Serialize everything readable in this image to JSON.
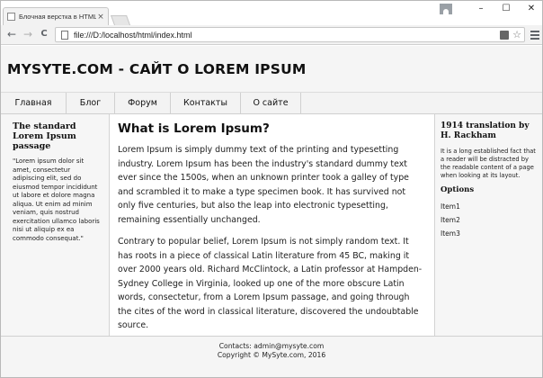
{
  "browser": {
    "tab_title": "Блочная верстка в HTML",
    "tab_close": "×",
    "window_controls": {
      "minimize": "–",
      "maximize": "☐",
      "close": "✕"
    },
    "nav": {
      "back": "←",
      "forward": "→",
      "reload": "C"
    },
    "address": "file:///D:/localhost/html/index.html",
    "star": "☆"
  },
  "site": {
    "title": "MYSYTE.COM - САЙТ О LOREM IPSUM",
    "menu": [
      "Главная",
      "Блог",
      "Форум",
      "Контакты",
      "О сайте"
    ]
  },
  "left": {
    "heading": "The standard Lorem Ipsum passage",
    "text": "\"Lorem ipsum dolor sit amet, consectetur adipiscing elit, sed do eiusmod tempor incididunt ut labore et dolore magna aliqua. Ut enim ad minim veniam, quis nostrud exercitation ullamco laboris nisi ut aliquip ex ea commodo consequat.\""
  },
  "main": {
    "heading": "What is Lorem Ipsum?",
    "paragraphs": [
      "Lorem Ipsum is simply dummy text of the printing and typesetting industry. Lorem Ipsum has been the industry's standard dummy text ever since the 1500s, when an unknown printer took a galley of type and scrambled it to make a type specimen book. It has survived not only five centuries, but also the leap into electronic typesetting, remaining essentially unchanged.",
      "Contrary to popular belief, Lorem Ipsum is not simply random text. It has roots in a piece of classical Latin literature from 45 BC, making it over 2000 years old. Richard McClintock, a Latin professor at Hampden-Sydney College in Virginia, looked up one of the more obscure Latin words, consectetur, from a Lorem Ipsum passage, and going through the cites of the word in classical literature, discovered the undoubtable source."
    ]
  },
  "right": {
    "heading": "1914 translation by H. Rackham",
    "text": "It is a long established fact that a reader will be distracted by the readable content of a page when looking at its layout.",
    "options_heading": "Options",
    "options": [
      "Item1",
      "Item2",
      "Item3"
    ]
  },
  "footer": {
    "contacts": "Contacts: admin@mysyte.com",
    "copyright": "Copyright © MySyte.com, 2016"
  }
}
